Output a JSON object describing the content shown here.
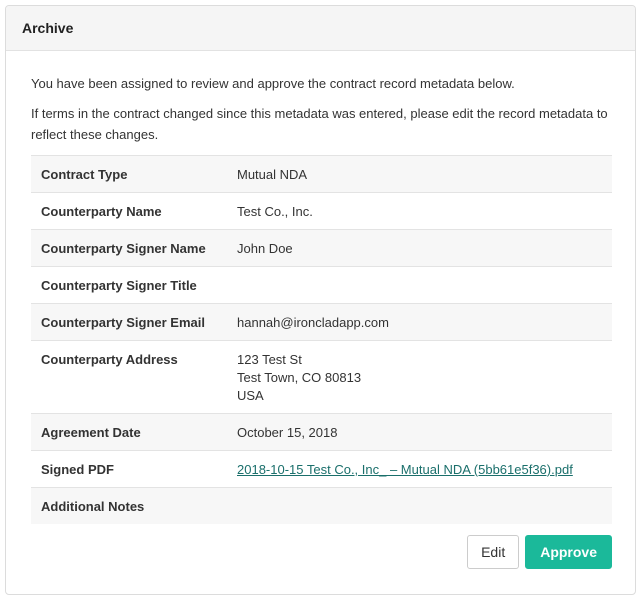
{
  "panel": {
    "title": "Archive"
  },
  "intro": {
    "line1": "You have been assigned to review and approve the contract record metadata below.",
    "line2": "If terms in the contract changed since this metadata was entered, please edit the record metadata to reflect these changes."
  },
  "fields": [
    {
      "label": "Contract Type",
      "value": "Mutual NDA"
    },
    {
      "label": "Counterparty Name",
      "value": "Test Co., Inc."
    },
    {
      "label": "Counterparty Signer Name",
      "value": "John Doe"
    },
    {
      "label": "Counterparty Signer Title",
      "value": ""
    },
    {
      "label": "Counterparty Signer Email",
      "value": "hannah@ironcladapp.com"
    },
    {
      "label": "Counterparty Address",
      "value_lines": [
        "123 Test St",
        "Test Town, CO 80813",
        "USA"
      ]
    },
    {
      "label": "Agreement Date",
      "value": "October 15, 2018"
    },
    {
      "label": "Signed PDF",
      "value": "2018-10-15 Test Co., Inc_ – Mutual NDA (5bb61e5f36).pdf"
    },
    {
      "label": "Additional Notes",
      "value": ""
    }
  ],
  "actions": {
    "edit_label": "Edit",
    "approve_label": "Approve"
  },
  "colors": {
    "approve": "#1bb99a",
    "link": "#1a6f6b",
    "header_bg": "#f5f5f5",
    "row_stripe": "#f7f7f7"
  }
}
